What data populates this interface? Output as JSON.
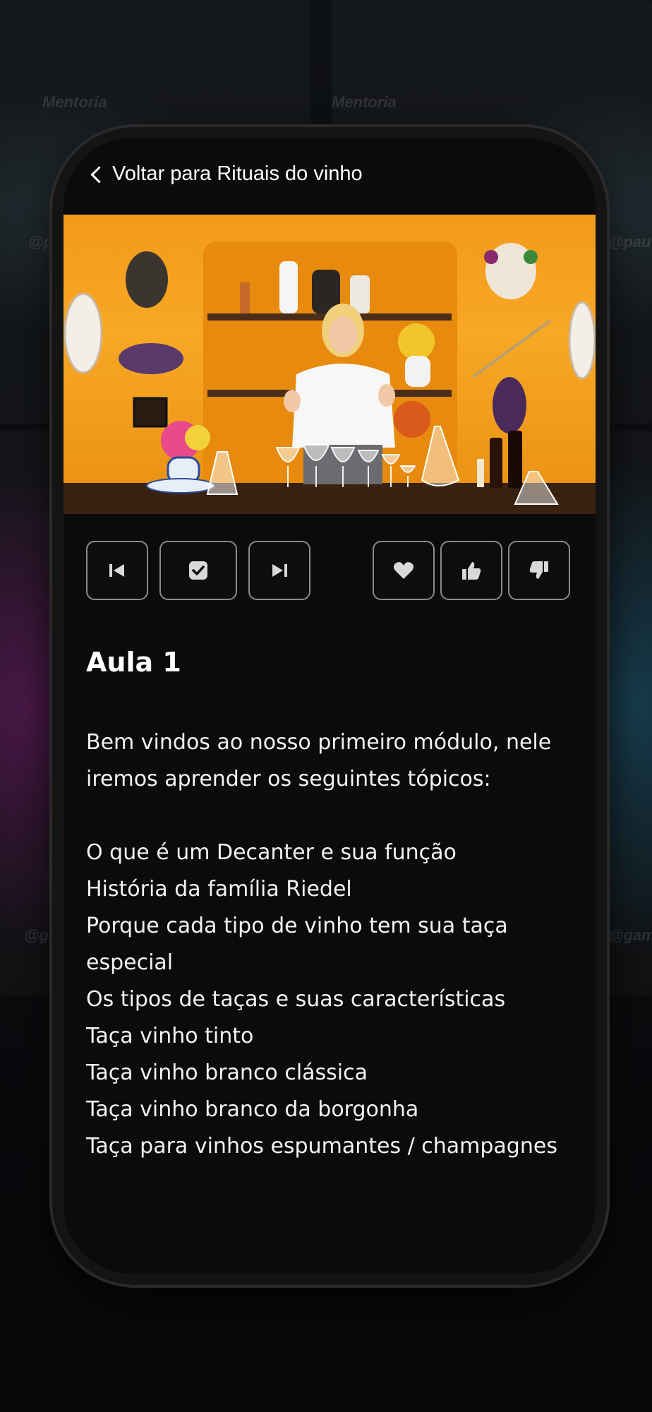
{
  "navigation": {
    "back_label": "Voltar para Rituais do vinho"
  },
  "video": {
    "description_icon": "video-thumbnail"
  },
  "controls": {
    "left": [
      {
        "name": "previous-lesson-button",
        "icon": "skip-previous-icon"
      },
      {
        "name": "mark-complete-button",
        "icon": "check-square-icon"
      },
      {
        "name": "next-lesson-button",
        "icon": "skip-next-icon"
      }
    ],
    "right": [
      {
        "name": "favorite-button",
        "icon": "heart-icon"
      },
      {
        "name": "like-button",
        "icon": "thumbs-up-icon"
      },
      {
        "name": "dislike-button",
        "icon": "thumbs-down-icon"
      }
    ]
  },
  "lesson": {
    "title": "Aula 1",
    "intro": "Bem vindos ao nosso primeiro módulo, nele iremos aprender os seguintes tópicos:",
    "topics": [
      "O que é um Decanter e sua função",
      "História da família Riedel",
      "Porque cada tipo de vinho tem sua taça especial",
      "Os tipos de taças e suas características",
      "Taça vinho tinto",
      "Taça vinho branco clássica",
      "Taça vinho branco da borgonha",
      "Taça para vinhos espumantes / champagnes"
    ]
  },
  "background": {
    "texts": [
      "Mentoria",
      "Mentoria",
      "@pa",
      "@pau",
      "@ga",
      "@gam"
    ]
  },
  "colors": {
    "screen_bg": "#0b0b0b",
    "button_border": "#8a8a8a",
    "video_wall": "#f39a1c"
  }
}
